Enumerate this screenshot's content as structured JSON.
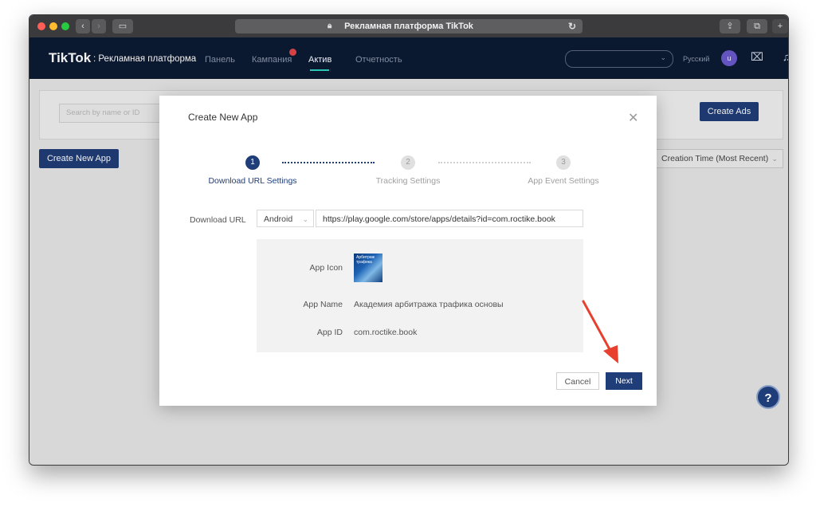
{
  "browser": {
    "title": "Рекламная платформа TikTok"
  },
  "nav": {
    "logo": "TikTok",
    "logo_sub": ": Рекламная платформа",
    "items": [
      {
        "label": "Панель"
      },
      {
        "label": "Кампания"
      },
      {
        "label": "Актив"
      },
      {
        "label": "Отчетность"
      }
    ],
    "language": "Русский",
    "avatar_letter": "u"
  },
  "page": {
    "search_placeholder": "Search by name or ID",
    "create_ads_label": "Create Ads",
    "create_app_label": "Create New App",
    "sort_label": "Creation Time (Most Recent)"
  },
  "modal": {
    "title": "Create New App",
    "steps": [
      {
        "number": "1",
        "label": "Download URL Settings"
      },
      {
        "number": "2",
        "label": "Tracking Settings"
      },
      {
        "number": "3",
        "label": "App Event Settings"
      }
    ],
    "download_url_label": "Download URL",
    "os_value": "Android",
    "url_value": "https://play.google.com/store/apps/details?id=com.roctike.book",
    "preview": {
      "icon_label": "App Icon",
      "icon_text": "Арбитраж трафика",
      "name_label": "App Name",
      "name_value": "Академия арбитража трафика основы",
      "id_label": "App ID",
      "id_value": "com.roctike.book"
    },
    "cancel_label": "Cancel",
    "next_label": "Next"
  },
  "colors": {
    "nav_bg": "#0b1a34",
    "primary": "#1f3d78",
    "accent_underline": "#2fd3c4",
    "arrow": "#e8402e"
  },
  "icons": [
    "back-icon",
    "forward-icon",
    "sidebar-icon",
    "lock-icon",
    "reload-icon",
    "share-icon",
    "tabs-icon",
    "new-tab-icon",
    "chevron-down-icon",
    "notification-dot",
    "briefcase-icon",
    "bell-icon",
    "close-icon",
    "help-icon",
    "arrow-annotation"
  ]
}
